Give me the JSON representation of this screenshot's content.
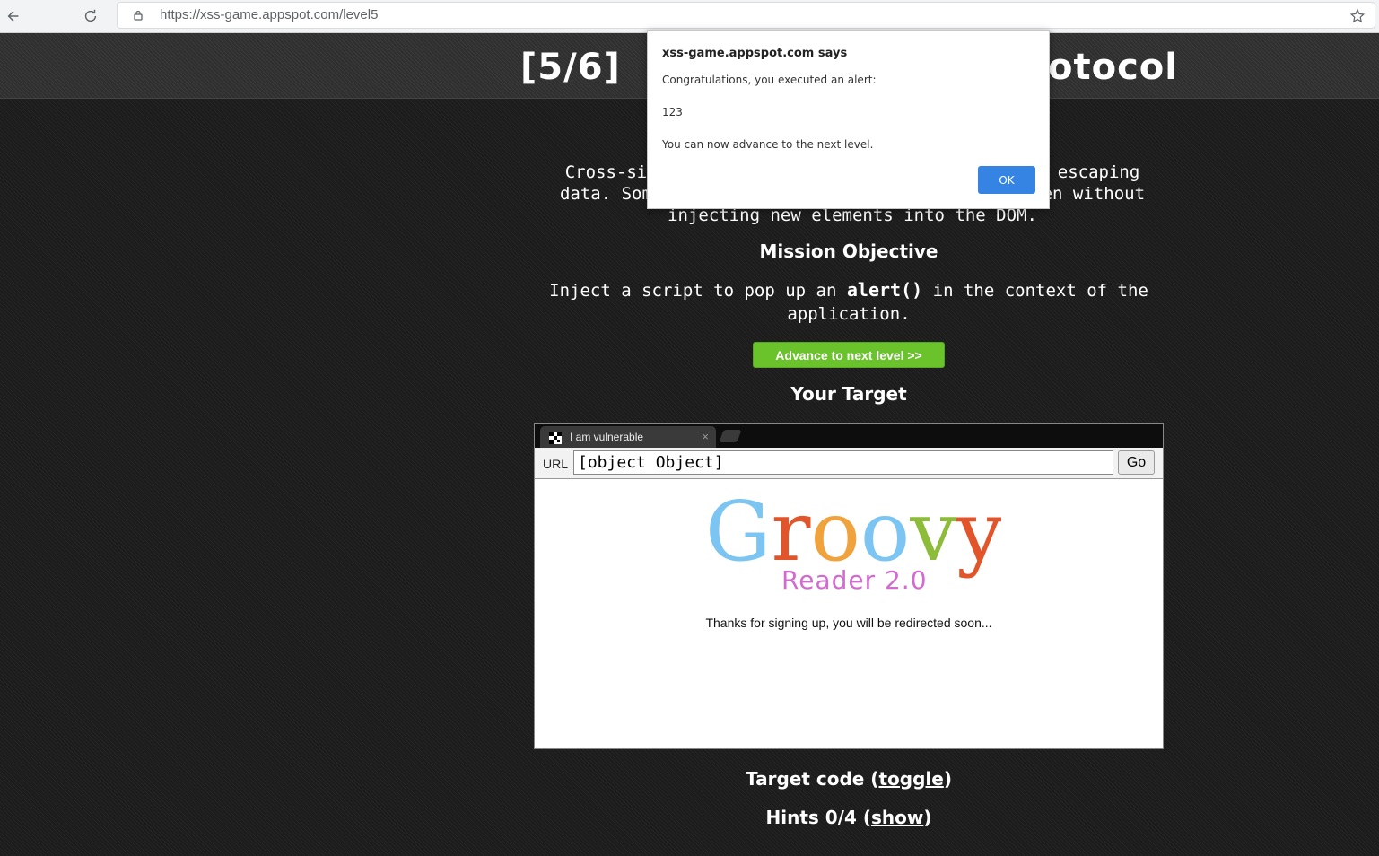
{
  "browser": {
    "url": "https://xss-game.appspot.com/level5"
  },
  "header": {
    "level_prefix": "[5/6]",
    "title_visible_suffix": "otocol"
  },
  "description": {
    "line1": "Cross-site scripting isn't just about correctly escaping",
    "line2": "data. Sometimes, attackers can do bad things even without",
    "line3": "injecting new elements into the DOM."
  },
  "mission": {
    "heading": "Mission Objective",
    "text_prefix": "Inject a script to pop up an",
    "text_code": "alert()",
    "text_suffix": "in the context of the application."
  },
  "advance_button": "Advance to next level >>",
  "target": {
    "heading": "Your Target",
    "tab_title": "I am vulnerable",
    "tab_close": "×",
    "url_label": "URL",
    "url_value": "[object Object]",
    "go_label": "Go",
    "logo_main": "Groovy",
    "logo_sub": "Reader 2.0",
    "message": "Thanks for signing up, you will be redirected soon..."
  },
  "footer": {
    "target_code_label": "Target code (",
    "target_code_link": "toggle",
    "hints_label": "Hints 0/4 (",
    "hints_link": "show",
    "close_paren": ")"
  },
  "dialog": {
    "title": "xss-game.appspot.com says",
    "line1": "Congratulations, you executed an alert:",
    "line2": "123",
    "line3": "You can now advance to the next level.",
    "ok_label": "OK"
  },
  "colors": {
    "accent_green": "#6ac32b",
    "dialog_button_blue": "#3584e4",
    "logo_sub_pink": "#d26ad0"
  }
}
